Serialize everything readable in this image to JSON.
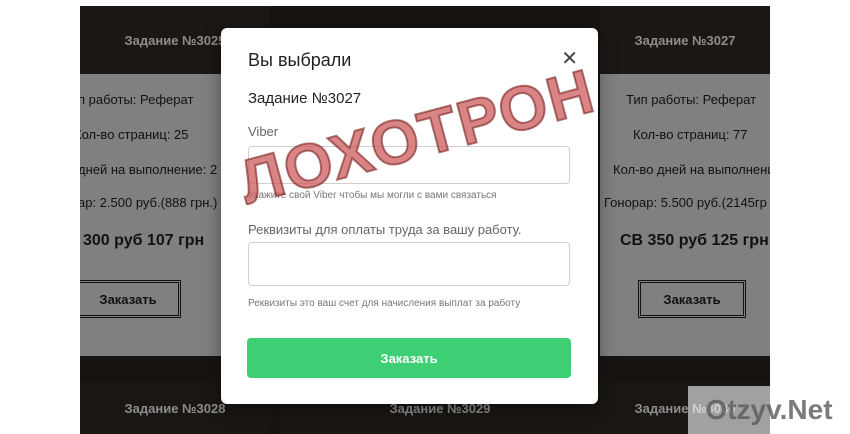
{
  "background": {
    "headers": [
      "Задание №3025",
      "Задание №3027"
    ],
    "cards": [
      {
        "type": "п работы: Реферат",
        "pages": "Кол-во страниц: 25",
        "days": "дней на выполнение: 2",
        "fee": "ар: 2.500 руб.(888 грн.)",
        "price": "300 руб 107 грн",
        "order": "Заказать"
      },
      {
        "type": "Тип работы: Реферат",
        "pages": "Кол-во страниц: 77",
        "days": "Кол-во дней на выполнение",
        "fee": "Гонорар: 5.500 руб.(2145гр",
        "price": "СВ  350 руб 125 грн",
        "order": "Заказать"
      }
    ],
    "footers": [
      "Задание №3028",
      "Задание №3029",
      "Задание №3030"
    ]
  },
  "modal": {
    "title": "Вы выбрали",
    "close_icon": "close-icon",
    "task": "Задание №3027",
    "viber_label": "Viber",
    "viber_value": "",
    "viber_hint": "Укажите свой Viber чтобы мы могли с вами связаться",
    "requisites_label": "Реквизиты для оплаты труда за вашу работу.",
    "requisites_value": "",
    "requisites_hint": "Реквизиты это ваш счет для начисления выплат за работу",
    "submit": "Заказать"
  },
  "stamp": "ЛОХОТРОН",
  "watermark": "Otzyv.Net",
  "colors": {
    "submit": "#3ecf74",
    "stamp": "#cd5c5c"
  }
}
